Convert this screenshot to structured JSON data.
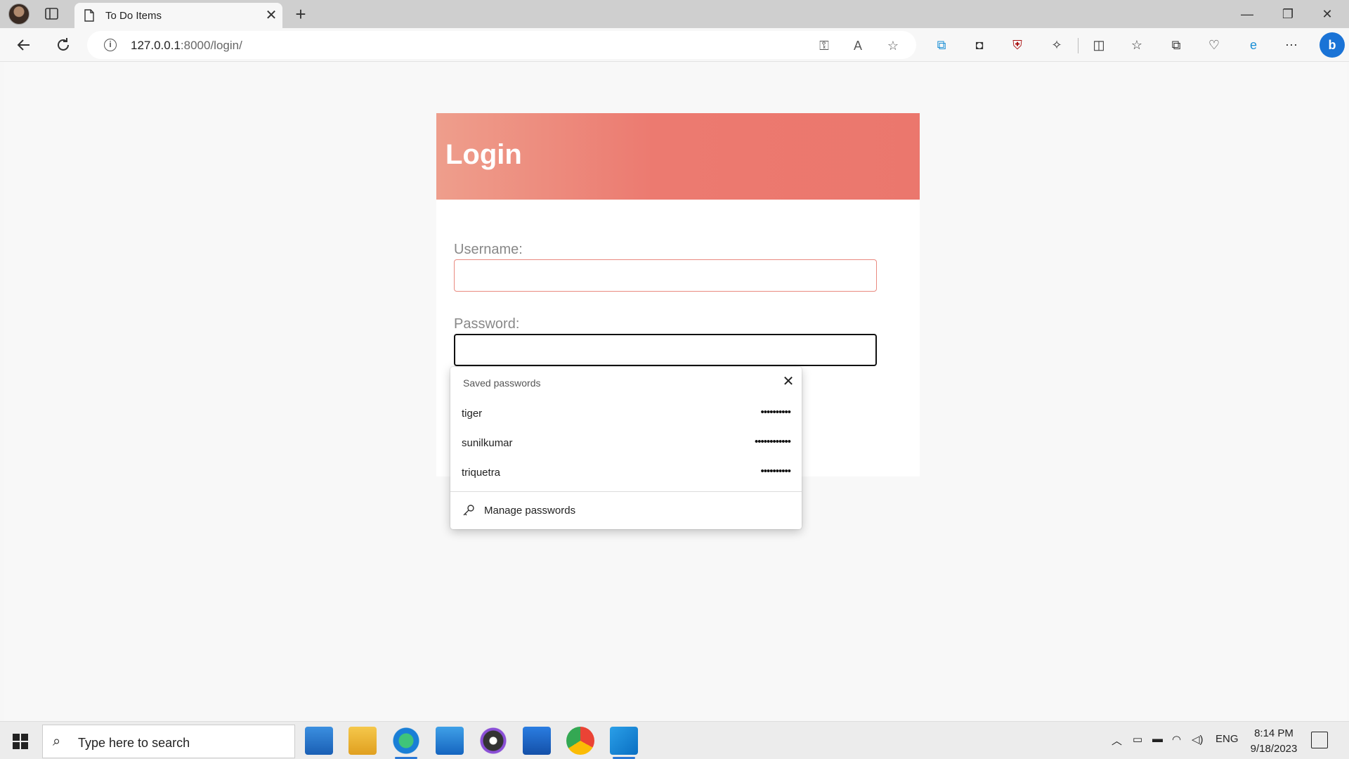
{
  "browser": {
    "tab_title": "To Do Items",
    "tab_close": "✕",
    "new_tab": "+",
    "url_host": "127.0.0.1",
    "url_path": ":8000/login/",
    "window_controls": {
      "minimize": "—",
      "restore": "❐",
      "close": "✕"
    }
  },
  "login": {
    "title": "Login",
    "username_label": "Username:",
    "password_label": "Password:"
  },
  "saved_passwords": {
    "title": "Saved passwords",
    "close": "✕",
    "entries": [
      {
        "username": "tiger",
        "password_mask": "••••••••••"
      },
      {
        "username": "sunilkumar",
        "password_mask": "••••••••••••"
      },
      {
        "username": "triquetra",
        "password_mask": "••••••••••"
      }
    ],
    "manage_label": "Manage passwords"
  },
  "taskbar": {
    "search_placeholder": "Type here to search",
    "language": "ENG",
    "time": "8:14 PM",
    "date": "9/18/2023"
  },
  "colors": {
    "header_gradient_start": "#ee9e8c",
    "header_gradient_end": "#eb776d",
    "username_border": "#e98a80",
    "accent": "#2a78d6"
  }
}
